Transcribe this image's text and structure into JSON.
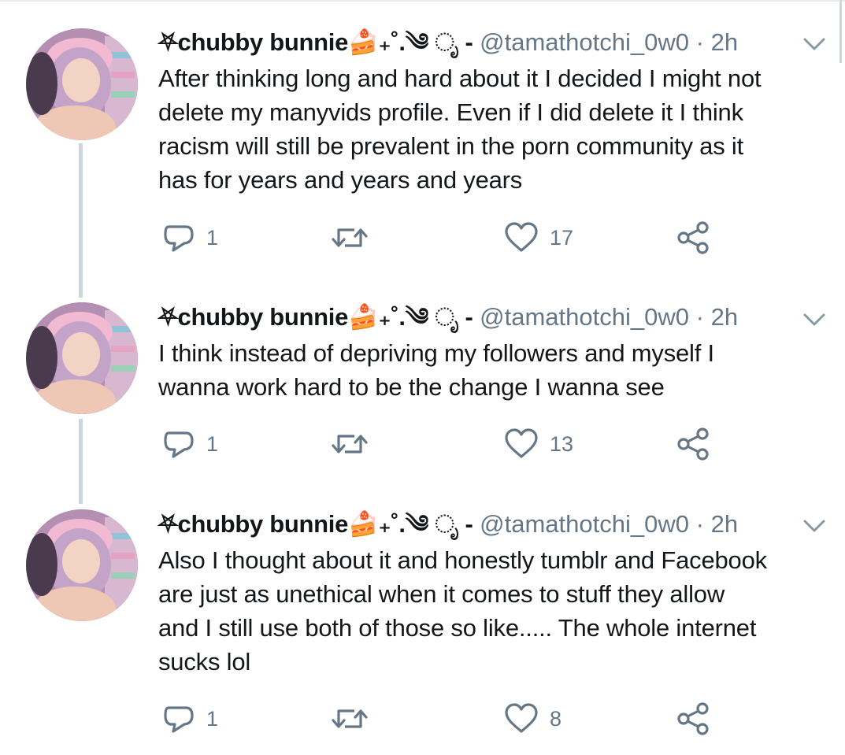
{
  "colors": {
    "text": "#14171a",
    "secondary": "#657786",
    "thread": "#ccd6dd"
  },
  "tweets": [
    {
      "name": "⛧chubby bunnie🍰₊˚.༄ ೃ -",
      "handle": "@tamathotchi_0w0",
      "sep": "·",
      "time": "2h",
      "lines": [
        "After thinking long and hard about it I decided I might not",
        "delete my manyvids profile. Even if I did delete it I think",
        "racism will still be prevalent in the porn community as it",
        "has for years and years and years"
      ],
      "replies": "1",
      "retweets": "",
      "likes": "17"
    },
    {
      "name": "⛧chubby bunnie🍰₊˚.༄ ೃ -",
      "handle": "@tamathotchi_0w0",
      "sep": "·",
      "time": "2h",
      "lines": [
        "I think instead of depriving my followers and myself I",
        "wanna work hard to be the change I wanna see"
      ],
      "replies": "1",
      "retweets": "",
      "likes": "13"
    },
    {
      "name": "⛧chubby bunnie🍰₊˚.༄ ೃ -",
      "handle": "@tamathotchi_0w0",
      "sep": "·",
      "time": "2h",
      "lines": [
        "Also I thought about it and honestly tumblr and Facebook",
        "are just as unethical when it comes to stuff they allow",
        "and I still use both of those so like..... The whole internet",
        "sucks lol"
      ],
      "replies": "1",
      "retweets": "",
      "likes": "8"
    }
  ],
  "icons": {
    "reply": "reply-icon",
    "retweet": "retweet-icon",
    "like": "heart-icon",
    "share": "share-icon",
    "menu": "chevron-down-icon"
  }
}
